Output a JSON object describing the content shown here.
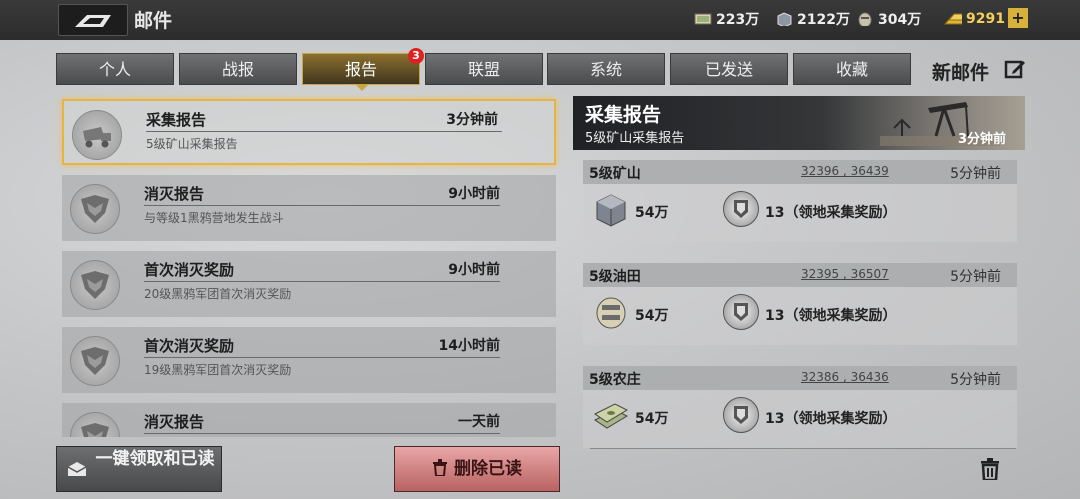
{
  "header": {
    "title": "邮件",
    "resources": [
      {
        "icon": "cash-icon",
        "value": "223万"
      },
      {
        "icon": "steel-icon",
        "value": "2122万"
      },
      {
        "icon": "oil-icon",
        "value": "304万"
      },
      {
        "icon": "gold-icon",
        "value": "9291"
      }
    ],
    "add_label": "+"
  },
  "tabs": [
    {
      "label": "个人"
    },
    {
      "label": "战报"
    },
    {
      "label": "报告",
      "active": true,
      "badge": "3"
    },
    {
      "label": "联盟"
    },
    {
      "label": "系统"
    },
    {
      "label": "已发送"
    },
    {
      "label": "收藏"
    }
  ],
  "new_mail_label": "新邮件",
  "mails": [
    {
      "subject": "采集报告",
      "time": "3分钟前",
      "desc": "5级矿山采集报告",
      "icon": "mining-truck-icon"
    },
    {
      "subject": "消灭报告",
      "time": "9小时前",
      "desc": "与等级1黑鸦营地发生战斗",
      "icon": "raven-emblem-icon"
    },
    {
      "subject": "首次消灭奖励",
      "time": "9小时前",
      "desc": "20级黑鸦军团首次消灭奖励",
      "icon": "raven-emblem-icon"
    },
    {
      "subject": "首次消灭奖励",
      "time": "14小时前",
      "desc": "19级黑鸦军团首次消灭奖励",
      "icon": "raven-emblem-icon"
    },
    {
      "subject": "消灭报告",
      "time": "一天前",
      "desc": "",
      "icon": "raven-emblem-icon"
    }
  ],
  "buttons": {
    "claim_all": "一键领取和已读",
    "delete_read": "删除已读"
  },
  "detail": {
    "title": "采集报告",
    "subtitle": "5级矿山采集报告",
    "time": "3分钟前",
    "cards": [
      {
        "name": "5级矿山",
        "coord": "32396 , 36439",
        "time": "5分钟前",
        "resource_icon": "steel-crate-icon",
        "amount": "54万",
        "reward": "13（领地采集奖励）"
      },
      {
        "name": "5级油田",
        "coord": "32395 , 36507",
        "time": "5分钟前",
        "resource_icon": "oil-drum-icon",
        "amount": "54万",
        "reward": "13（领地采集奖励）"
      },
      {
        "name": "5级农庄",
        "coord": "32386 , 36436",
        "time": "5分钟前",
        "resource_icon": "cash-stack-icon",
        "amount": "54万",
        "reward": "13（领地采集奖励）"
      }
    ]
  }
}
